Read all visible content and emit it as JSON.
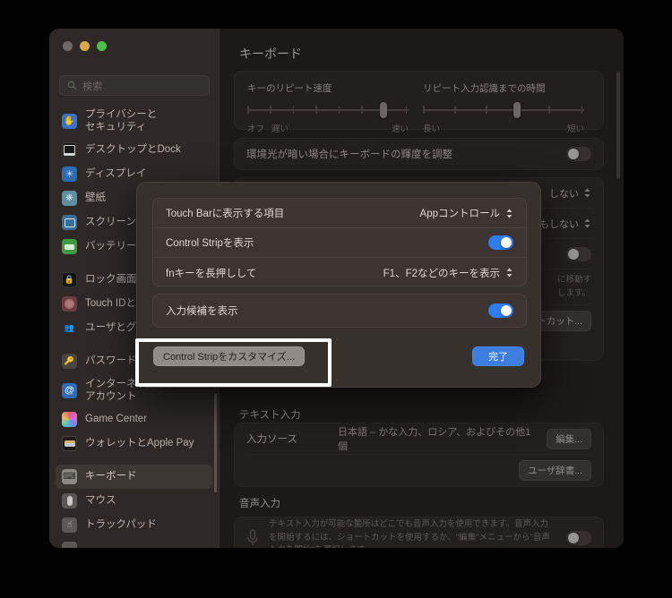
{
  "window": {
    "traffic_lights": [
      "close",
      "minimize",
      "zoom"
    ],
    "search": {
      "placeholder": "検索",
      "icon": "search-icon"
    }
  },
  "sidebar": {
    "items": [
      {
        "label": "プライバシーと\nセキュリティ",
        "icon": "privacy-hand-icon",
        "selected": false,
        "tall": true
      },
      {
        "label": "デスクトップとDock",
        "icon": "desktop-dock-icon",
        "selected": false
      },
      {
        "label": "ディスプレイ",
        "icon": "display-icon",
        "selected": false
      },
      {
        "label": "壁紙",
        "icon": "wallpaper-icon",
        "selected": false
      },
      {
        "label": "スクリーンセーバ",
        "icon": "screensaver-icon",
        "selected": false
      },
      {
        "label": "バッテリー",
        "icon": "battery-icon",
        "selected": false
      },
      {
        "label": "ロック画面",
        "icon": "lock-screen-icon",
        "selected": false
      },
      {
        "label": "Touch IDとパスコード",
        "icon": "touch-id-icon",
        "selected": false
      },
      {
        "label": "ユーザとグループ",
        "icon": "users-groups-icon",
        "selected": false
      },
      {
        "label": "パスワード",
        "icon": "passwords-key-icon",
        "selected": false
      },
      {
        "label": "インターネット\nアカウント",
        "icon": "internet-accounts-icon",
        "selected": false,
        "tall": true
      },
      {
        "label": "Game Center",
        "icon": "game-center-icon",
        "selected": false
      },
      {
        "label": "ウォレットとApple Pay",
        "icon": "wallet-apple-pay-icon",
        "selected": false
      },
      {
        "label": "キーボード",
        "icon": "keyboard-icon",
        "selected": true
      },
      {
        "label": "マウス",
        "icon": "mouse-icon",
        "selected": false
      },
      {
        "label": "トラックパッド",
        "icon": "trackpad-icon",
        "selected": false
      }
    ]
  },
  "main": {
    "title": "キーボード",
    "key_repeat": {
      "label": "キーのリピート速度",
      "left_labels": [
        "オフ",
        "遅い"
      ],
      "right_label": "速い",
      "ticks": 8,
      "value_index": 7
    },
    "repeat_delay": {
      "label": "リピート入力認識までの時間",
      "left_label": "長い",
      "right_label": "短い",
      "ticks": 6,
      "value_index": 3
    },
    "ambient": {
      "label": "環境光が暗い場合にキーボードの輝度を調整",
      "toggle": "on"
    },
    "obscured_rows": [
      {
        "popup_value": "しない"
      },
      {
        "popup_value": "何もしない"
      },
      {
        "toggle": "off"
      },
      {
        "note": "に移動す\nします。"
      },
      {
        "button": "ートカット..."
      }
    ],
    "text_input": {
      "section": "テキスト入力",
      "source_label": "入力ソース",
      "source_value": "日本語 – かな入力、ロシア、およびその他1個",
      "edit_button": "編集...",
      "dictionary_button": "ユーザ辞書..."
    },
    "voice_input": {
      "section": "音声入力",
      "icon": "microphone-icon",
      "description": "テキスト入力が可能な箇所はどこでも音声入力を使用できます。音声入力を開始するには、ショートカットを使用するか、\"編集\"メニューから\"音声入力を開始\"を選択します。",
      "toggle": "off"
    }
  },
  "sheet": {
    "rows": [
      {
        "label": "Touch Barに表示する項目",
        "type": "popup",
        "value": "Appコントロール"
      },
      {
        "label": "Control Stripを表示",
        "type": "toggle",
        "value": "on"
      },
      {
        "label": "fnキーを長押しして",
        "type": "popup",
        "value": "F1、F2などのキーを表示"
      }
    ],
    "rows2": [
      {
        "label": "入力候補を表示",
        "type": "toggle",
        "value": "on"
      }
    ],
    "customize_button": "Control Stripをカスタマイズ...",
    "done_button": "完了"
  },
  "colors": {
    "accent_blue": "#2f7cf6",
    "done_button": "#3b7ee0",
    "highlight_border": "#ffffff",
    "window_bg": "#2a2523",
    "sidebar_bg": "#2e2926",
    "sheet_bg": "#37312e"
  }
}
